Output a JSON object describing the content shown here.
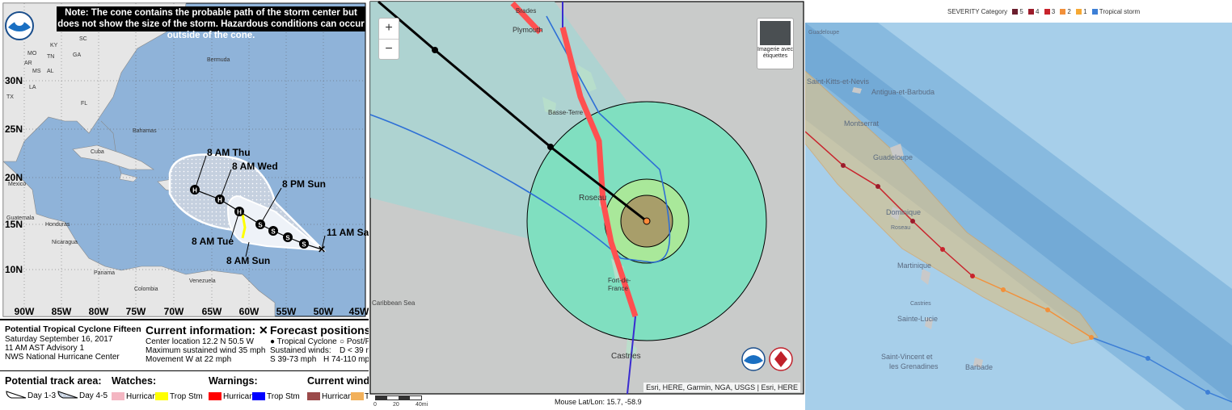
{
  "panel1": {
    "note": "Note: The cone contains the probable path of the storm center but does not show the size of the storm. Hazardous conditions can occur outside of the cone.",
    "lat_labels": [
      "30N",
      "25N",
      "20N",
      "15N",
      "10N"
    ],
    "lon_labels": [
      "90W",
      "85W",
      "80W",
      "75W",
      "70W",
      "65W",
      "60W",
      "55W",
      "50W",
      "45W"
    ],
    "place_labels": {
      "mo": "MO",
      "ky": "KY",
      "tn": "TN",
      "ar": "AR",
      "ms": "MS",
      "al": "AL",
      "ga": "GA",
      "sc": "SC",
      "la": "LA",
      "tx": "TX",
      "fl": "FL",
      "bermuda": "Bermuda",
      "bahamas": "Bahamas",
      "cuba": "Cuba",
      "mexico": "Mexico",
      "honduras": "Honduras",
      "nicaragua": "Nicaragua",
      "panama": "Panama",
      "colombia": "Colombia",
      "venezuela": "Venezuela",
      "guatemala": "Guatemala"
    },
    "forecast_labels": [
      "8 AM Thu",
      "8 AM Wed",
      "8 PM Sun",
      "11 AM Sat",
      "8 AM Tue",
      "8 AM Sun"
    ],
    "markers": {
      "hurricane": "H",
      "storm": "S"
    },
    "info": {
      "title": "Potential Tropical Cyclone Fifteen",
      "date": "Saturday September 16, 2017",
      "advisory": "11 AM AST Advisory 1",
      "center": "NWS National Hurricane Center",
      "current_heading": "Current information: ✕",
      "location": "Center location 12.2 N 50.5 W",
      "wind": "Maximum sustained wind 35 mph",
      "movement": "Movement W at 22 mph",
      "forecast_heading": "Forecast positions:",
      "tropical_cyclone": "Tropical Cyclone",
      "post": "Post/P",
      "sustained": "Sustained winds:",
      "d_range": "D < 39 m",
      "s_range": "S 39-73 mph",
      "h_range": "H 74-110 mph",
      "m_range": "M",
      "track_heading": "Potential track area:",
      "day13": "Day 1-3",
      "day45": "Day 4-5",
      "watches_heading": "Watches:",
      "watch_hurricane": "Hurricane",
      "watch_trop": "Trop Stm",
      "warnings_heading": "Warnings:",
      "warn_hurricane": "Hurricane",
      "warn_trop": "Trop Stm",
      "current_wind_heading": "Current wind e",
      "cw_hurricane": "Hurricane",
      "cw_t": "T"
    },
    "colors": {
      "hurricane_watch": "#f4b6c2",
      "trop_watch": "#ffff00",
      "hurricane_warning": "#ff0000",
      "trop_warning": "#0000ff",
      "cw_hurricane": "#9b4a4a",
      "cw_trop": "#f2b05a"
    }
  },
  "panel2": {
    "labels": {
      "brades": "Brades",
      "plymouth": "Plymouth",
      "basse_terre": "Basse-Terre",
      "roseau": "Roseau",
      "fort_de_france": "Fort-de-France",
      "castries": "Castries",
      "caribbean_sea": "Caribbean Sea"
    },
    "zoom_in": "+",
    "zoom_out": "−",
    "basemap_label": "Imagerie avec étiquettes",
    "attribution": "Esri, HERE, Garmin, NGA, USGS | Esri, HERE",
    "mouse": "Mouse Lat/Lon: 15.7, -58.9",
    "scale_labels": [
      "0",
      "20",
      "40mi"
    ],
    "colors": {
      "sea": "#a9d5d2",
      "land": "#c8cac9",
      "outer_radius": "#80dfc0",
      "mid_radius": "#a9e89a",
      "inner_radius": "#a89e6a",
      "track": "#ff5050"
    }
  },
  "panel3": {
    "legend": {
      "severity": "SEVERITY",
      "category": "Category",
      "items": [
        {
          "label": "5",
          "color": "#6b1e2e"
        },
        {
          "label": "4",
          "color": "#9c1c2b"
        },
        {
          "label": "3",
          "color": "#c8232c"
        },
        {
          "label": "2",
          "color": "#f2903a"
        },
        {
          "label": "1",
          "color": "#f6a833"
        },
        {
          "label": "Tropical storm",
          "color": "#3d7fd6"
        }
      ]
    },
    "places": {
      "guadeloupe_small": "Guadeloupe",
      "saint_kitts": "Saint-Kitts-et-Nevis",
      "antigua": "Antigua-et-Barbuda",
      "montserrat": "Montserrat",
      "guadeloupe": "Guadeloupe",
      "dominique": "Dominique",
      "roseau": "Roseau",
      "martinique": "Martinique",
      "castries": "Castries",
      "sainte_lucie": "Sainte-Lucie",
      "saint_vincent": "Saint-Vincent et",
      "grenadines": "les Grenadines",
      "barbade": "Barbade"
    },
    "colors": {
      "sea": "#9cc8e6",
      "cone": "#d8c08a",
      "track_red": "#c8232c",
      "track_orange": "#f2903a",
      "track_blue": "#3d7fd6"
    }
  }
}
